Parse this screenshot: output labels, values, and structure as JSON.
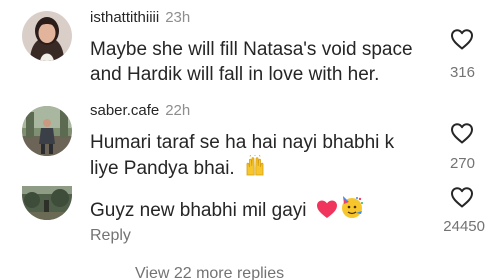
{
  "comments": [
    {
      "username": "isthattithiiii",
      "time": "23h",
      "text_line1": "Maybe she will fill Natasa's void space",
      "text_line2": "and Hardik will fall in love with her.",
      "likes": "316"
    },
    {
      "username": "saber.cafe",
      "time": "22h",
      "text_line1": "Humari taraf se ha hai nayi bhabhi k",
      "text_line2": "liye Pandya bhai.",
      "likes": "270"
    },
    {
      "text_line1": "Guyz new bhabhi mil gayi",
      "likes": "24450",
      "reply_label": "Reply"
    }
  ],
  "view_more_replies": "View 22 more replies",
  "icons": {
    "like": "heart-outline-icon",
    "raised_hands": "raising-hands-emoji",
    "red_heart": "red-heart-emoji",
    "party_face": "partying-face-emoji"
  },
  "colors": {
    "text": "#262626",
    "muted": "#8e8e8e",
    "heart_red": "#f0345c",
    "emoji_yellow": "#f7c52c"
  }
}
